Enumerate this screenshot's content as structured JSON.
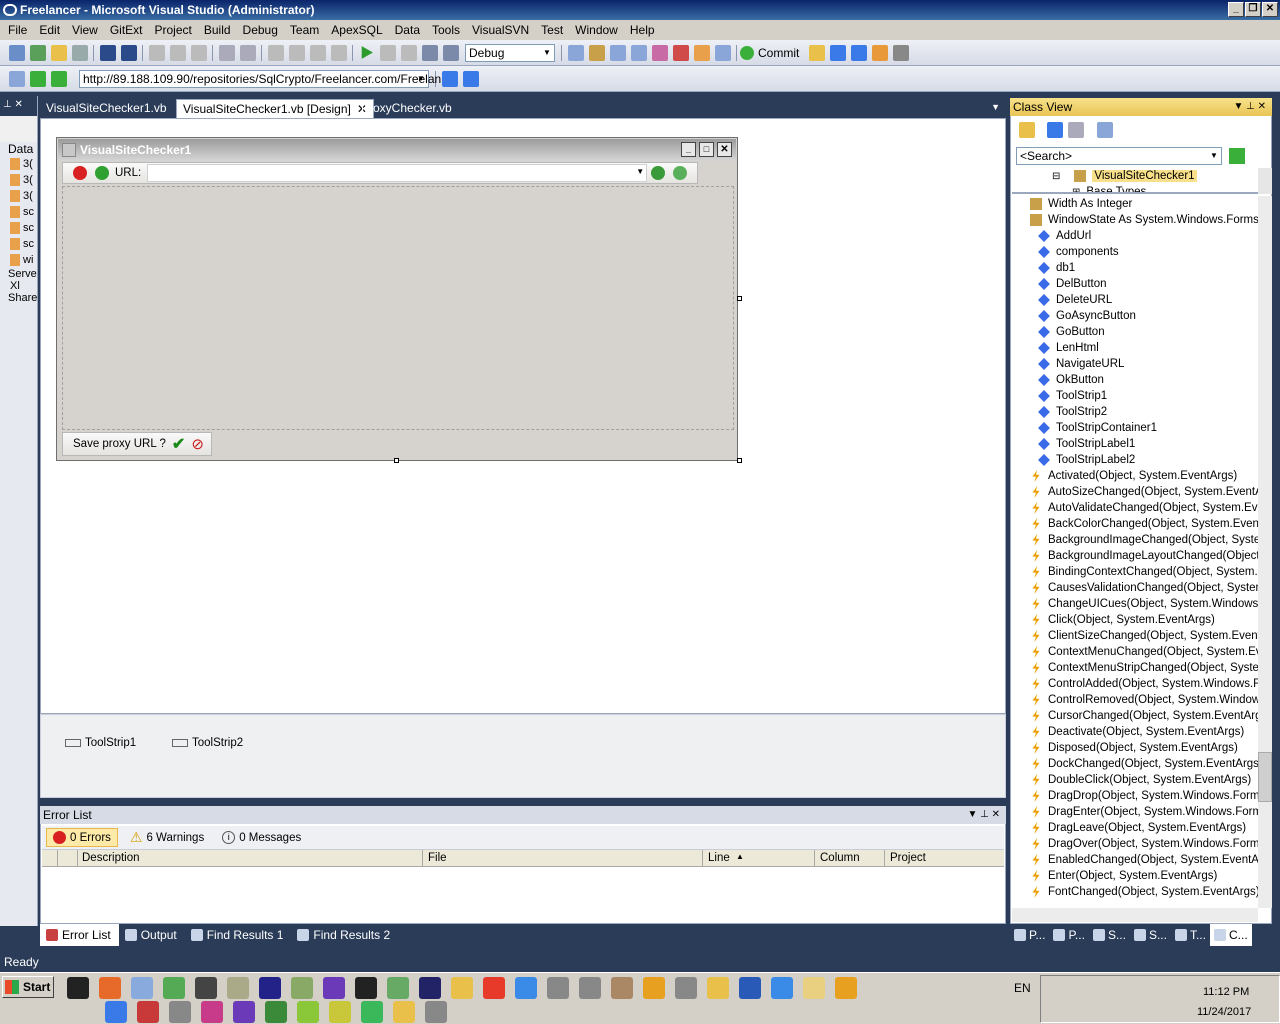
{
  "window": {
    "title": "Freelancer - Microsoft Visual Studio (Administrator)"
  },
  "menu": [
    "File",
    "Edit",
    "View",
    "GitExt",
    "Project",
    "Build",
    "Debug",
    "Team",
    "ApexSQL",
    "Data",
    "Tools",
    "VisualSVN",
    "Test",
    "Window",
    "Help"
  ],
  "toolbar": {
    "config": "Debug",
    "commit_label": "Commit",
    "url": "http://89.188.109.90/repositories/SqlCrypto/Freelancer.com/Freelan"
  },
  "tabs": [
    "VisualSiteChecker1.vb",
    "VisualSiteChecker1.vb [Design]",
    "ProxyChecker.vb"
  ],
  "left_panel": {
    "header": "Data",
    "items": [
      "3(",
      "3(",
      "3(",
      "sc",
      "sc",
      "sc",
      "wi"
    ],
    "server": "Serve",
    "xml": "Xl",
    "share": "Share"
  },
  "form": {
    "title": "VisualSiteChecker1",
    "url_label": "URL:",
    "save_label": "Save proxy URL ?"
  },
  "tray": [
    "ToolStrip1",
    "ToolStrip2"
  ],
  "error_list": {
    "title": "Error List",
    "errors": "0 Errors",
    "warnings": "6 Warnings",
    "messages": "0 Messages",
    "columns": [
      "Description",
      "File",
      "Line",
      "Column",
      "Project"
    ]
  },
  "bottom_tabs": [
    "Error List",
    "Output",
    "Find Results 1",
    "Find Results 2"
  ],
  "class_view": {
    "title": "Class View",
    "search": "<Search>",
    "tree_selected": "VisualSiteChecker1",
    "tree_next": "Base Types",
    "members": [
      {
        "name": "Width As Integer",
        "kind": "prop"
      },
      {
        "name": "WindowState As System.Windows.Forms.F",
        "kind": "prop"
      },
      {
        "name": "AddUrl",
        "kind": "field"
      },
      {
        "name": "components",
        "kind": "field"
      },
      {
        "name": "db1",
        "kind": "field"
      },
      {
        "name": "DelButton",
        "kind": "field"
      },
      {
        "name": "DeleteURL",
        "kind": "field"
      },
      {
        "name": "GoAsyncButton",
        "kind": "field"
      },
      {
        "name": "GoButton",
        "kind": "field"
      },
      {
        "name": "LenHtml",
        "kind": "field"
      },
      {
        "name": "NavigateURL",
        "kind": "field"
      },
      {
        "name": "OkButton",
        "kind": "field"
      },
      {
        "name": "ToolStrip1",
        "kind": "field"
      },
      {
        "name": "ToolStrip2",
        "kind": "field"
      },
      {
        "name": "ToolStripContainer1",
        "kind": "field"
      },
      {
        "name": "ToolStripLabel1",
        "kind": "field"
      },
      {
        "name": "ToolStripLabel2",
        "kind": "field"
      },
      {
        "name": "Activated(Object, System.EventArgs)",
        "kind": "event"
      },
      {
        "name": "AutoSizeChanged(Object, System.EventArgs",
        "kind": "event"
      },
      {
        "name": "AutoValidateChanged(Object, System.Even",
        "kind": "event"
      },
      {
        "name": "BackColorChanged(Object, System.EventA",
        "kind": "event"
      },
      {
        "name": "BackgroundImageChanged(Object, System",
        "kind": "event"
      },
      {
        "name": "BackgroundImageLayoutChanged(Object, S",
        "kind": "event"
      },
      {
        "name": "BindingContextChanged(Object, System.Ev",
        "kind": "event"
      },
      {
        "name": "CausesValidationChanged(Object, System.I",
        "kind": "event"
      },
      {
        "name": "ChangeUICues(Object, System.Windows.F",
        "kind": "event"
      },
      {
        "name": "Click(Object, System.EventArgs)",
        "kind": "event"
      },
      {
        "name": "ClientSizeChanged(Object, System.EventA",
        "kind": "event"
      },
      {
        "name": "ContextMenuChanged(Object, System.Eve",
        "kind": "event"
      },
      {
        "name": "ContextMenuStripChanged(Object, System",
        "kind": "event"
      },
      {
        "name": "ControlAdded(Object, System.Windows.Fo",
        "kind": "event"
      },
      {
        "name": "ControlRemoved(Object, System.Windows.",
        "kind": "event"
      },
      {
        "name": "CursorChanged(Object, System.EventArgs",
        "kind": "event"
      },
      {
        "name": "Deactivate(Object, System.EventArgs)",
        "kind": "event"
      },
      {
        "name": "Disposed(Object, System.EventArgs)",
        "kind": "event"
      },
      {
        "name": "DockChanged(Object, System.EventArgs)",
        "kind": "event"
      },
      {
        "name": "DoubleClick(Object, System.EventArgs)",
        "kind": "event"
      },
      {
        "name": "DragDrop(Object, System.Windows.Forms.",
        "kind": "event"
      },
      {
        "name": "DragEnter(Object, System.Windows.Forms",
        "kind": "event"
      },
      {
        "name": "DragLeave(Object, System.EventArgs)",
        "kind": "event"
      },
      {
        "name": "DragOver(Object, System.Windows.Forms.",
        "kind": "event"
      },
      {
        "name": "EnabledChanged(Object, System.EventArg",
        "kind": "event"
      },
      {
        "name": "Enter(Object, System.EventArgs)",
        "kind": "event"
      },
      {
        "name": "FontChanged(Object, System.EventArgs)",
        "kind": "event"
      }
    ],
    "bottom_tabs": [
      "P...",
      "P...",
      "S...",
      "S...",
      "T...",
      "C..."
    ]
  },
  "status": "Ready",
  "taskbar": {
    "start": "Start",
    "lang": "EN",
    "time": "11:12 PM",
    "date": "11/24/2017"
  }
}
